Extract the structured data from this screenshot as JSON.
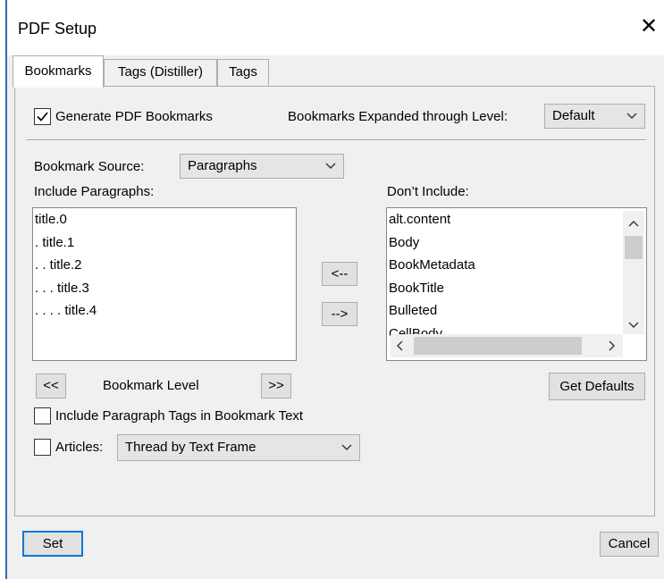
{
  "window": {
    "title": "PDF Setup",
    "close_glyph": "✕"
  },
  "tabs": [
    {
      "label": "Bookmarks",
      "active": true
    },
    {
      "label": "Tags (Distiller)",
      "active": false
    },
    {
      "label": "Tags",
      "active": false
    }
  ],
  "bookmarks": {
    "generate_label": "Generate PDF Bookmarks",
    "generate_checked": true,
    "expanded_label": "Bookmarks Expanded through Level:",
    "expanded_value": "Default",
    "source_label": "Bookmark Source:",
    "source_value": "Paragraphs",
    "include_label": "Include Paragraphs:",
    "include_items": [
      "title.0",
      ". title.1",
      ". . title.2",
      ". . . title.3",
      ". . . . title.4"
    ],
    "dont_include_label": "Don’t Include:",
    "dont_include_items": [
      "alt.content",
      "Body",
      "BookMetadata",
      "BookTitle",
      "Bulleted",
      "CellBody"
    ],
    "move_left": "<--",
    "move_right": "-->",
    "level_down": "<<",
    "level_label": "Bookmark Level",
    "level_up": ">>",
    "get_defaults": "Get Defaults",
    "include_tags_label": "Include Paragraph Tags in Bookmark Text",
    "include_tags_checked": false,
    "articles_label": "Articles:",
    "articles_checked": false,
    "articles_value": "Thread by Text Frame"
  },
  "footer": {
    "set": "Set",
    "cancel": "Cancel"
  },
  "colors": {
    "accent": "#0078d7",
    "face": "#f0f0f0",
    "button": "#e1e1e1",
    "border": "#adadad"
  },
  "icons": [
    "close-icon",
    "checkmark-icon",
    "chevron-down-icon",
    "scroll-up-icon",
    "scroll-down-icon",
    "scroll-left-icon",
    "scroll-right-icon"
  ]
}
